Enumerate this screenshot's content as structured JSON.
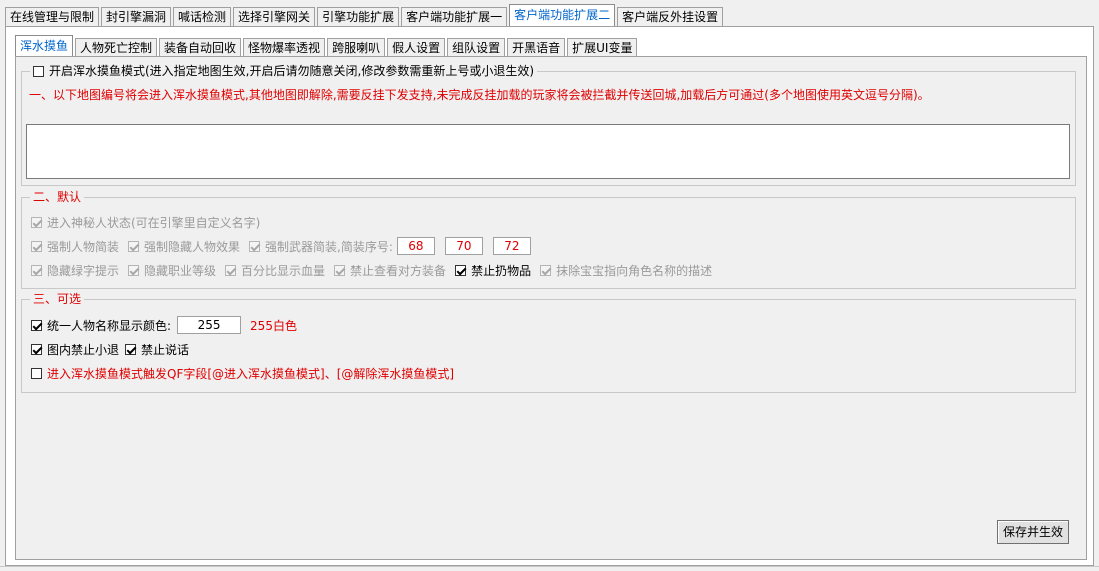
{
  "top_tabs": [
    {
      "label": "在线管理与限制",
      "active": false
    },
    {
      "label": "封引擎漏洞",
      "active": false
    },
    {
      "label": "喊话检测",
      "active": false
    },
    {
      "label": "选择引擎网关",
      "active": false
    },
    {
      "label": "引擎功能扩展",
      "active": false
    },
    {
      "label": "客户端功能扩展一",
      "active": false
    },
    {
      "label": "客户端功能扩展二",
      "active": true
    },
    {
      "label": "客户端反外挂设置",
      "active": false
    }
  ],
  "sub_tabs": [
    {
      "label": "浑水摸鱼",
      "active": true
    },
    {
      "label": "人物死亡控制",
      "active": false
    },
    {
      "label": "装备自动回收",
      "active": false
    },
    {
      "label": "怪物爆率透视",
      "active": false
    },
    {
      "label": "跨服喇叭",
      "active": false
    },
    {
      "label": "假人设置",
      "active": false
    },
    {
      "label": "组队设置",
      "active": false
    },
    {
      "label": "开黑语音",
      "active": false
    },
    {
      "label": "扩展UI变量",
      "active": false
    }
  ],
  "section1": {
    "enable_label": "开启浑水摸鱼模式(进入指定地图生效,开启后请勿随意关闭,修改参数需重新上号或小退生效)",
    "enable_checked": false,
    "note": "一、以下地图编号将会进入浑水摸鱼模式,其他地图即解除,需要反挂下发支持,未完成反挂加载的玩家将会被拦截并传送回城,加载后方可通过(多个地图使用英文逗号分隔)。",
    "map_list": ""
  },
  "section2": {
    "title": "二、默认",
    "mystery_label": "进入神秘人状态(可在引擎里自定义名字)",
    "force_simple_label": "强制人物简装",
    "force_hide_effect_label": "强制隐藏人物效果",
    "force_weapon_label": "强制武器简装,简装序号:",
    "seq1": "68",
    "seq2": "70",
    "seq3": "72",
    "hide_green_label": "隐藏绿字提示",
    "hide_job_label": "隐藏职业等级",
    "percent_hp_label": "百分比显示血量",
    "no_view_equip_label": "禁止查看对方装备",
    "no_throw_label": "禁止扔物品",
    "erase_pet_label": "抹除宝宝指向角色名称的描述"
  },
  "section3": {
    "title": "三、可选",
    "unify_color_label": "统一人物名称显示颜色:",
    "unify_color_checked": true,
    "color_value": "255",
    "color_hint": "255白色",
    "no_logout_label": "图内禁止小退",
    "no_logout_checked": true,
    "no_talk_label": "禁止说话",
    "no_talk_checked": true,
    "qf_label": "进入浑水摸鱼模式触发QF字段[@进入浑水摸鱼模式]、[@解除浑水摸鱼模式]",
    "qf_checked": false
  },
  "save_button": "保存并生效"
}
